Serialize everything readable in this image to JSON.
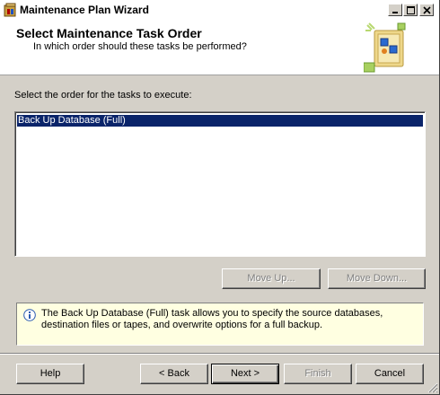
{
  "window": {
    "title": "Maintenance Plan Wizard"
  },
  "header": {
    "title": "Select Maintenance Task Order",
    "subtitle": "In which order should these tasks be performed?"
  },
  "list": {
    "label": "Select the order for the tasks to execute:",
    "items": [
      "Back Up Database (Full)"
    ]
  },
  "buttons": {
    "move_up": "Move Up...",
    "move_down": "Move Down...",
    "help": "Help",
    "back": "< Back",
    "next": "Next >",
    "finish": "Finish",
    "cancel": "Cancel"
  },
  "info": {
    "text": "The Back Up Database (Full) task allows you to specify the source databases, destination files or tapes, and overwrite options for a full backup."
  },
  "colors": {
    "selection": "#0a246a",
    "info_background": "#ffffe1",
    "face": "#d4d0c8"
  }
}
